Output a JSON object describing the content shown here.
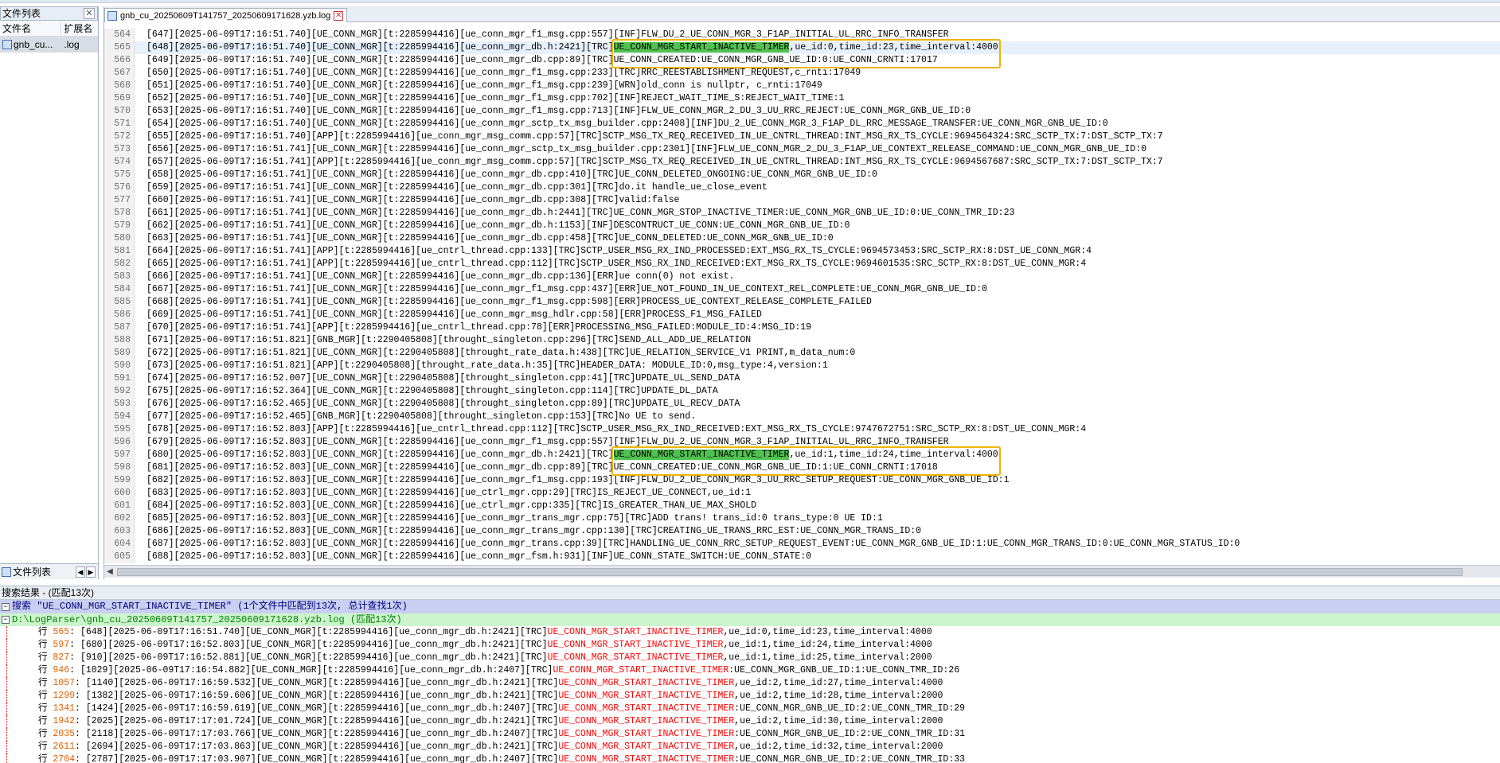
{
  "sidebar": {
    "title": "文件列表",
    "col_name": "文件名",
    "col_ext": "扩展名",
    "file_name": "gnb_cu...",
    "file_ext": ".log",
    "bottom_tab": "文件列表"
  },
  "editor": {
    "tab_title": "gnb_cu_20250609T141757_20250609171628.yzb.log"
  },
  "lines": [
    {
      "n": "564",
      "t": "[647][2025-06-09T17:16:51.740][UE_CONN_MGR][t:2285994416][ue_conn_mgr_f1_msg.cpp:557][INF]FLW_DU_2_UE_CONN_MGR_3_F1AP_INITIAL_UL_RRC_INFO_TRANSFER"
    },
    {
      "n": "565",
      "t": "[648][2025-06-09T17:16:51.740][UE_CONN_MGR][t:2285994416][ue_conn_mgr_db.h:2421][TRC]",
      "k": "UE_CONN_MGR_START_INACTIVE_TIMER",
      "r": ",ue_id:0,time_id:23,time_interval:4000",
      "cur": true
    },
    {
      "n": "566",
      "t": "[649][2025-06-09T17:16:51.740][UE_CONN_MGR][t:2285994416][ue_conn_mgr_db.cpp:89][TRC]UE_CONN_CREATED:UE_CONN_MGR_GNB_UE_ID:0:UE_CONN_CRNTI:17017"
    },
    {
      "n": "567",
      "t": "[650][2025-06-09T17:16:51.740][UE_CONN_MGR][t:2285994416][ue_conn_mgr_f1_msg.cpp:233][TRC]RRC_REESTABLISHMENT_REQUEST,c_rnti:17049"
    },
    {
      "n": "568",
      "t": "[651][2025-06-09T17:16:51.740][UE_CONN_MGR][t:2285994416][ue_conn_mgr_f1_msg.cpp:239][WRN]old_conn is nullptr, c_rnti:17049"
    },
    {
      "n": "569",
      "t": "[652][2025-06-09T17:16:51.740][UE_CONN_MGR][t:2285994416][ue_conn_mgr_f1_msg.cpp:702][INF]REJECT_WAIT_TIME_S:REJECT_WAIT_TIME:1"
    },
    {
      "n": "570",
      "t": "[653][2025-06-09T17:16:51.740][UE_CONN_MGR][t:2285994416][ue_conn_mgr_f1_msg.cpp:713][INF]FLW_UE_CONN_MGR_2_DU_3_UU_RRC_REJECT:UE_CONN_MGR_GNB_UE_ID:0"
    },
    {
      "n": "571",
      "t": "[654][2025-06-09T17:16:51.740][UE_CONN_MGR][t:2285994416][ue_conn_mgr_sctp_tx_msg_builder.cpp:2408][INF]DU_2_UE_CONN_MGR_3_F1AP_DL_RRC_MESSAGE_TRANSFER:UE_CONN_MGR_GNB_UE_ID:0"
    },
    {
      "n": "572",
      "t": "[655][2025-06-09T17:16:51.740][APP][t:2285994416][ue_conn_mgr_msg_comm.cpp:57][TRC]SCTP_MSG_TX_REQ_RECEIVED_IN_UE_CNTRL_THREAD:INT_MSG_RX_TS_CYCLE:9694564324:SRC_SCTP_TX:7:DST_SCTP_TX:7"
    },
    {
      "n": "573",
      "t": "[656][2025-06-09T17:16:51.741][UE_CONN_MGR][t:2285994416][ue_conn_mgr_sctp_tx_msg_builder.cpp:2301][INF]FLW_UE_CONN_MGR_2_DU_3_F1AP_UE_CONTEXT_RELEASE_COMMAND:UE_CONN_MGR_GNB_UE_ID:0"
    },
    {
      "n": "574",
      "t": "[657][2025-06-09T17:16:51.741][APP][t:2285994416][ue_conn_mgr_msg_comm.cpp:57][TRC]SCTP_MSG_TX_REQ_RECEIVED_IN_UE_CNTRL_THREAD:INT_MSG_RX_TS_CYCLE:9694567687:SRC_SCTP_TX:7:DST_SCTP_TX:7"
    },
    {
      "n": "575",
      "t": "[658][2025-06-09T17:16:51.741][UE_CONN_MGR][t:2285994416][ue_conn_mgr_db.cpp:410][TRC]UE_CONN_DELETED_ONGOING:UE_CONN_MGR_GNB_UE_ID:0"
    },
    {
      "n": "576",
      "t": "[659][2025-06-09T17:16:51.741][UE_CONN_MGR][t:2285994416][ue_conn_mgr_db.cpp:301][TRC]do.it handle_ue_close_event"
    },
    {
      "n": "577",
      "t": "[660][2025-06-09T17:16:51.741][UE_CONN_MGR][t:2285994416][ue_conn_mgr_db.cpp:308][TRC]valid:false"
    },
    {
      "n": "578",
      "t": "[661][2025-06-09T17:16:51.741][UE_CONN_MGR][t:2285994416][ue_conn_mgr_db.h:2441][TRC]UE_CONN_MGR_STOP_INACTIVE_TIMER:UE_CONN_MGR_GNB_UE_ID:0:UE_CONN_TMR_ID:23"
    },
    {
      "n": "579",
      "t": "[662][2025-06-09T17:16:51.741][UE_CONN_MGR][t:2285994416][ue_conn_mgr_db.h:1153][INF]DESCONTRUCT_UE_CONN:UE_CONN_MGR_GNB_UE_ID:0"
    },
    {
      "n": "580",
      "t": "[663][2025-06-09T17:16:51.741][UE_CONN_MGR][t:2285994416][ue_conn_mgr_db.cpp:458][TRC]UE_CONN_DELETED:UE_CONN_MGR_GNB_UE_ID:0"
    },
    {
      "n": "581",
      "t": "[664][2025-06-09T17:16:51.741][APP][t:2285994416][ue_cntrl_thread.cpp:133][TRC]SCTP_USER_MSG_RX_IND_PROCESSED:EXT_MSG_RX_TS_CYCLE:9694573453:SRC_SCTP_RX:8:DST_UE_CONN_MGR:4"
    },
    {
      "n": "582",
      "t": "[665][2025-06-09T17:16:51.741][APP][t:2285994416][ue_cntrl_thread.cpp:112][TRC]SCTP_USER_MSG_RX_IND_RECEIVED:EXT_MSG_RX_TS_CYCLE:9694601535:SRC_SCTP_RX:8:DST_UE_CONN_MGR:4"
    },
    {
      "n": "583",
      "t": "[666][2025-06-09T17:16:51.741][UE_CONN_MGR][t:2285994416][ue_conn_mgr_db.cpp:136][ERR]ue conn(0) not exist."
    },
    {
      "n": "584",
      "t": "[667][2025-06-09T17:16:51.741][UE_CONN_MGR][t:2285994416][ue_conn_mgr_f1_msg.cpp:437][ERR]UE_NOT_FOUND_IN_UE_CONTEXT_REL_COMPLETE:UE_CONN_MGR_GNB_UE_ID:0"
    },
    {
      "n": "585",
      "t": "[668][2025-06-09T17:16:51.741][UE_CONN_MGR][t:2285994416][ue_conn_mgr_f1_msg.cpp:598][ERR]PROCESS_UE_CONTEXT_RELEASE_COMPLETE_FAILED"
    },
    {
      "n": "586",
      "t": "[669][2025-06-09T17:16:51.741][UE_CONN_MGR][t:2285994416][ue_conn_mgr_msg_hdlr.cpp:58][ERR]PROCESS_F1_MSG_FAILED"
    },
    {
      "n": "587",
      "t": "[670][2025-06-09T17:16:51.741][APP][t:2285994416][ue_cntrl_thread.cpp:78][ERR]PROCESSING_MSG_FAILED:MODULE_ID:4:MSG_ID:19"
    },
    {
      "n": "588",
      "t": "[671][2025-06-09T17:16:51.821][GNB_MGR][t:2290405808][throught_singleton.cpp:296][TRC]SEND_ALL_ADD_UE_RELATION"
    },
    {
      "n": "589",
      "t": "[672][2025-06-09T17:16:51.821][UE_CONN_MGR][t:2290405808][throught_rate_data.h:438][TRC]UE_RELATION_SERVICE_V1 PRINT,m_data_num:0"
    },
    {
      "n": "590",
      "t": "[673][2025-06-09T17:16:51.821][APP][t:2290405808][throught_rate_data.h:35][TRC]HEADER_DATA: MODULE_ID:0,msg_type:4,version:1"
    },
    {
      "n": "591",
      "t": "[674][2025-06-09T17:16:52.007][UE_CONN_MGR][t:2290405808][throught_singleton.cpp:41][TRC]UPDATE_UL_SEND_DATA"
    },
    {
      "n": "592",
      "t": "[675][2025-06-09T17:16:52.364][UE_CONN_MGR][t:2290405808][throught_singleton.cpp:114][TRC]UPDATE_DL_DATA"
    },
    {
      "n": "593",
      "t": "[676][2025-06-09T17:16:52.465][UE_CONN_MGR][t:2290405808][throught_singleton.cpp:89][TRC]UPDATE_UL_RECV_DATA"
    },
    {
      "n": "594",
      "t": "[677][2025-06-09T17:16:52.465][GNB_MGR][t:2290405808][throught_singleton.cpp:153][TRC]No UE to send."
    },
    {
      "n": "595",
      "t": "[678][2025-06-09T17:16:52.803][APP][t:2285994416][ue_cntrl_thread.cpp:112][TRC]SCTP_USER_MSG_RX_IND_RECEIVED:EXT_MSG_RX_TS_CYCLE:9747672751:SRC_SCTP_RX:8:DST_UE_CONN_MGR:4"
    },
    {
      "n": "596",
      "t": "[679][2025-06-09T17:16:52.803][UE_CONN_MGR][t:2285994416][ue_conn_mgr_f1_msg.cpp:557][INF]FLW_DU_2_UE_CONN_MGR_3_F1AP_INITIAL_UL_RRC_INFO_TRANSFER"
    },
    {
      "n": "597",
      "t": "[680][2025-06-09T17:16:52.803][UE_CONN_MGR][t:2285994416][ue_conn_mgr_db.h:2421][TRC]",
      "k": "UE_CONN_MGR_START_INACTIVE_TIMER",
      "r": ",ue_id:1,time_id:24,time_interval:4000"
    },
    {
      "n": "598",
      "t": "[681][2025-06-09T17:16:52.803][UE_CONN_MGR][t:2285994416][ue_conn_mgr_db.cpp:89][TRC]UE_CONN_CREATED:UE_CONN_MGR_GNB_UE_ID:1:UE_CONN_CRNTI:17018"
    },
    {
      "n": "599",
      "t": "[682][2025-06-09T17:16:52.803][UE_CONN_MGR][t:2285994416][ue_conn_mgr_f1_msg.cpp:193][INF]FLW_DU_2_UE_CONN_MGR_3_UU_RRC_SETUP_REQUEST:UE_CONN_MGR_GNB_UE_ID:1"
    },
    {
      "n": "600",
      "t": "[683][2025-06-09T17:16:52.803][UE_CONN_MGR][t:2285994416][ue_ctrl_mgr.cpp:29][TRC]IS_REJECT_UE_CONNECT,ue_id:1"
    },
    {
      "n": "601",
      "t": "[684][2025-06-09T17:16:52.803][UE_CONN_MGR][t:2285994416][ue_ctrl_mgr.cpp:335][TRC]IS_GREATER_THAN_UE_MAX_SHOLD"
    },
    {
      "n": "602",
      "t": "[685][2025-06-09T17:16:52.803][UE_CONN_MGR][t:2285994416][ue_conn_mgr_trans_mgr.cpp:75][TRC]ADD trans! trans_id:0 trans_type:0 UE ID:1"
    },
    {
      "n": "603",
      "t": "[686][2025-06-09T17:16:52.803][UE_CONN_MGR][t:2285994416][ue_conn_mgr_trans_mgr.cpp:130][TRC]CREATING_UE_TRANS_RRC_EST:UE_CONN_MGR_TRANS_ID:0"
    },
    {
      "n": "604",
      "t": "[687][2025-06-09T17:16:52.803][UE_CONN_MGR][t:2285994416][ue_conn_mgr_trans.cpp:39][TRC]HANDLING_UE_CONN_RRC_SETUP_REQUEST_EVENT:UE_CONN_MGR_GNB_UE_ID:1:UE_CONN_MGR_TRANS_ID:0:UE_CONN_MGR_STATUS_ID:0"
    },
    {
      "n": "605",
      "t": "[688][2025-06-09T17:16:52.803][UE_CONN_MGR][t:2285994416][ue_conn_mgr_fsm.h:931][INF]UE_CONN_STATE_SWITCH:UE_CONN_STATE:0"
    }
  ],
  "results": {
    "header": "搜索结果 - (匹配13次)",
    "search_line": "搜索 \"UE_CONN_MGR_START_INACTIVE_TIMER\" (1个文件中匹配到13次, 总计查找1次)",
    "file_line": "D:\\LogParser\\gnb_cu_20250609T141757_20250609171628.yzb.log (匹配13次)",
    "hit_text": "UE_CONN_MGR_START_INACTIVE_TIMER",
    "row_prefix": "行",
    "rows": [
      {
        "n": "565",
        "pre": "[648][2025-06-09T17:16:51.740][UE_CONN_MGR][t:2285994416][ue_conn_mgr_db.h:2421][TRC]",
        "post": ",ue_id:0,time_id:23,time_interval:4000"
      },
      {
        "n": "597",
        "pre": "[680][2025-06-09T17:16:52.803][UE_CONN_MGR][t:2285994416][ue_conn_mgr_db.h:2421][TRC]",
        "post": ",ue_id:1,time_id:24,time_interval:4000"
      },
      {
        "n": "827",
        "pre": "[910][2025-06-09T17:16:52.881][UE_CONN_MGR][t:2285994416][ue_conn_mgr_db.h:2421][TRC]",
        "post": ",ue_id:1,time_id:25,time_interval:2000"
      },
      {
        "n": "946",
        "pre": "[1029][2025-06-09T17:16:54.882][UE_CONN_MGR][t:2285994416][ue_conn_mgr_db.h:2407][TRC]",
        "post": ":UE_CONN_MGR_GNB_UE_ID:1:UE_CONN_TMR_ID:26"
      },
      {
        "n": "1057",
        "pre": "[1140][2025-06-09T17:16:59.532][UE_CONN_MGR][t:2285994416][ue_conn_mgr_db.h:2421][TRC]",
        "post": ",ue_id:2,time_id:27,time_interval:4000"
      },
      {
        "n": "1299",
        "pre": "[1382][2025-06-09T17:16:59.606][UE_CONN_MGR][t:2285994416][ue_conn_mgr_db.h:2421][TRC]",
        "post": ",ue_id:2,time_id:28,time_interval:2000"
      },
      {
        "n": "1341",
        "pre": "[1424][2025-06-09T17:16:59.619][UE_CONN_MGR][t:2285994416][ue_conn_mgr_db.h:2407][TRC]",
        "post": ":UE_CONN_MGR_GNB_UE_ID:2:UE_CONN_TMR_ID:29"
      },
      {
        "n": "1942",
        "pre": "[2025][2025-06-09T17:17:01.724][UE_CONN_MGR][t:2285994416][ue_conn_mgr_db.h:2421][TRC]",
        "post": ",ue_id:2,time_id:30,time_interval:2000"
      },
      {
        "n": "2035",
        "pre": "[2118][2025-06-09T17:17:03.766][UE_CONN_MGR][t:2285994416][ue_conn_mgr_db.h:2407][TRC]",
        "post": ":UE_CONN_MGR_GNB_UE_ID:2:UE_CONN_TMR_ID:31"
      },
      {
        "n": "2611",
        "pre": "[2694][2025-06-09T17:17:03.863][UE_CONN_MGR][t:2285994416][ue_conn_mgr_db.h:2421][TRC]",
        "post": ",ue_id:2,time_id:32,time_interval:2000"
      },
      {
        "n": "2704",
        "pre": "[2787][2025-06-09T17:17:03.907][UE_CONN_MGR][t:2285994416][ue_conn_mgr_db.h:2407][TRC]",
        "post": ":UE_CONN_MGR_GNB_UE_ID:2:UE_CONN_TMR_ID:33"
      }
    ]
  }
}
